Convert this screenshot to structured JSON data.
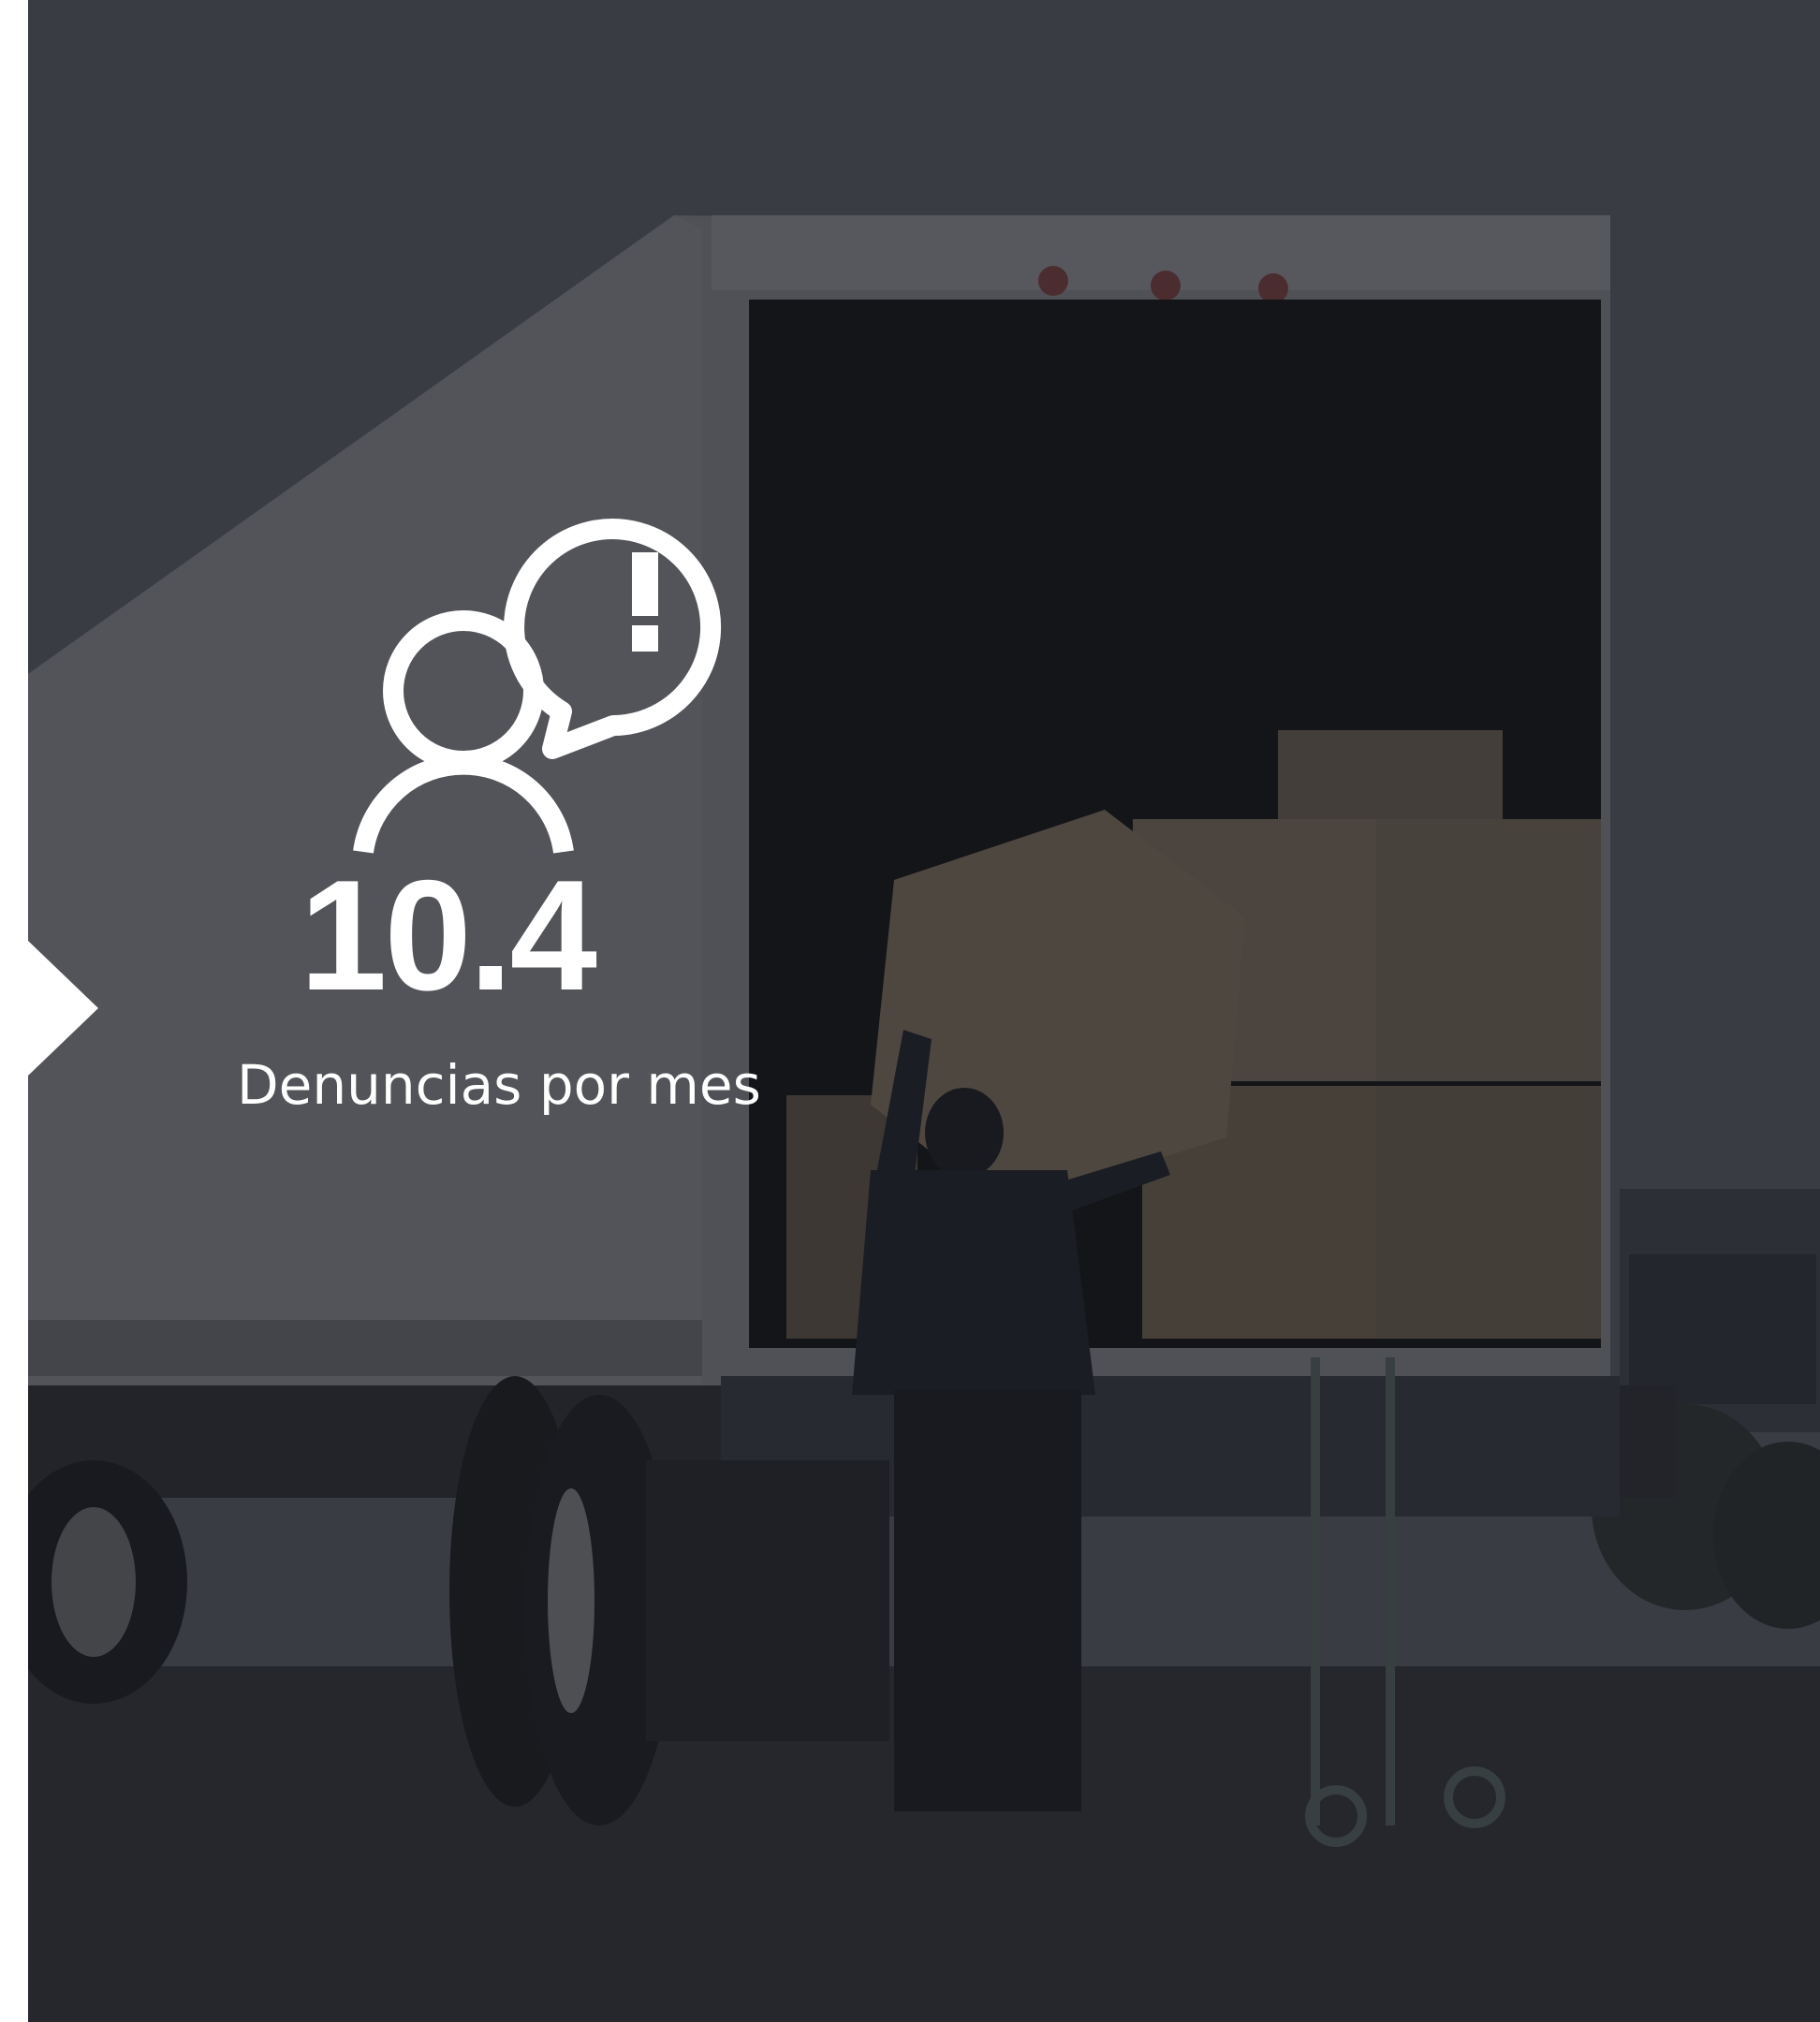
{
  "stat": {
    "value": "10.4",
    "label": "Denuncias por mes",
    "icon": "user-report-alert-icon"
  },
  "photo": {
    "subject": "truck-unloading-photo"
  },
  "colors": {
    "overlay": "#2e3037",
    "text": "#ffffff",
    "background": "#ffffff"
  }
}
